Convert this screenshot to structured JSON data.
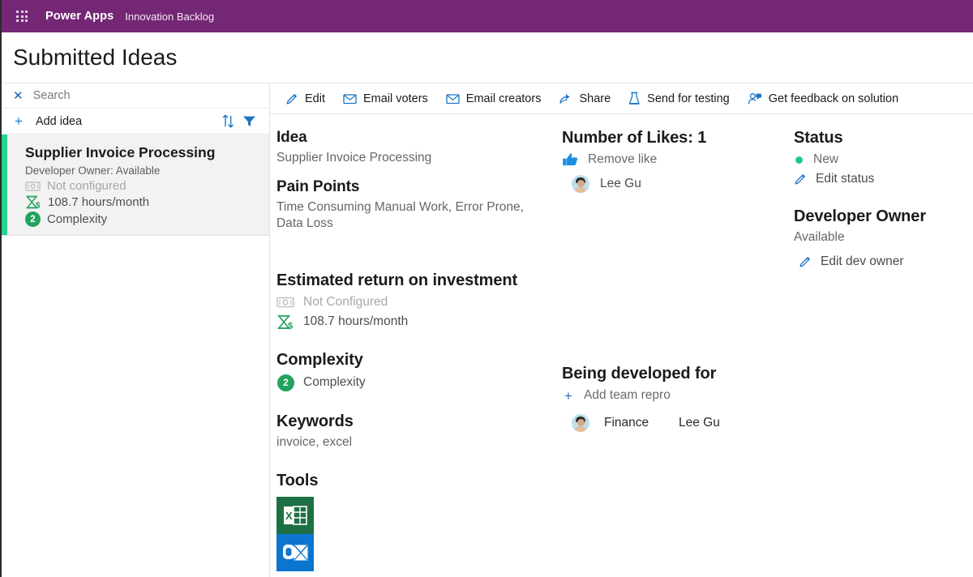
{
  "topbar": {
    "waffle_icon": "waffle-grid-icon",
    "brand": "Power Apps",
    "app_name": "Innovation Backlog",
    "background": "#742774"
  },
  "header": {
    "title": "Submitted Ideas"
  },
  "sidebar": {
    "search": {
      "placeholder": "Search",
      "clear_icon": "close-icon"
    },
    "add_idea": {
      "label": "Add idea",
      "plus_icon": "plus-icon"
    },
    "sort_icon": "sort-icon",
    "filter_icon": "filter-icon",
    "cards": [
      {
        "title": "Supplier Invoice Processing",
        "owner_line": "Developer Owner: Available",
        "money_icon": "money-icon",
        "money_text": "Not configured",
        "hours_icon": "hourglass-dollar-icon",
        "hours_text": "108.7 hours/month",
        "complexity_badge": "2",
        "complexity_text": "Complexity",
        "accent_color": "#22d68c",
        "selected": true
      }
    ]
  },
  "command_bar": {
    "items": [
      {
        "label": "Edit",
        "icon": "pencil-icon"
      },
      {
        "label": "Email voters",
        "icon": "mail-icon"
      },
      {
        "label": "Email creators",
        "icon": "mail-icon"
      },
      {
        "label": "Share",
        "icon": "share-icon"
      },
      {
        "label": "Send for testing",
        "icon": "beaker-icon"
      },
      {
        "label": "Get feedback on solution",
        "icon": "person-feedback-icon"
      }
    ]
  },
  "detail": {
    "idea": {
      "heading": "Idea",
      "value": "Supplier Invoice Processing"
    },
    "pain_points": {
      "heading": "Pain Points",
      "value": "Time Consuming Manual Work, Error Prone, Data Loss"
    },
    "roi": {
      "heading": "Estimated return on investment",
      "money_icon": "money-icon",
      "money_text": "Not Configured",
      "hours_icon": "hourglass-dollar-icon",
      "hours_text": "108.7 hours/month"
    },
    "complexity": {
      "heading": "Complexity",
      "badge": "2",
      "value": "Complexity"
    },
    "keywords": {
      "heading": "Keywords",
      "value": "invoice, excel"
    },
    "tools": {
      "heading": "Tools",
      "items": [
        {
          "name": "excel-tool-icon",
          "color": "#1d7044"
        },
        {
          "name": "outlook-tool-icon",
          "color": "#0b75d0"
        }
      ]
    },
    "likes": {
      "heading": "Number of Likes: 1",
      "count": 1,
      "action_label": "Remove like",
      "action_icon": "thumbs-up-icon",
      "voters": [
        {
          "name": "Lee Gu",
          "avatar": "avatar"
        }
      ]
    },
    "being_developed_for": {
      "heading": "Being developed for",
      "add_label": "Add team repro",
      "add_icon": "plus-icon",
      "rows": [
        {
          "team": "Finance",
          "person": "Lee Gu",
          "avatar": "avatar"
        }
      ]
    },
    "status": {
      "heading": "Status",
      "value": "New",
      "dot_color": "#1fc98a",
      "edit_label": "Edit status",
      "edit_icon": "pencil-icon"
    },
    "developer_owner": {
      "heading": "Developer Owner",
      "value": "Available",
      "edit_label": "Edit dev owner",
      "edit_icon": "pencil-icon"
    }
  }
}
